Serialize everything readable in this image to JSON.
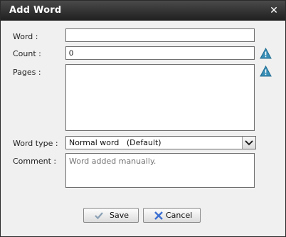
{
  "dialog": {
    "title": "Add Word",
    "close_icon": "close-icon"
  },
  "form": {
    "word_label": "Word :",
    "word_value": "",
    "count_label": "Count :",
    "count_value": "0",
    "pages_label": "Pages :",
    "pages_value": "",
    "word_type_label": "Word type :",
    "word_type_value": "Normal word   (Default)",
    "comment_label": "Comment :",
    "comment_placeholder": "Word added manually.",
    "warning_icon": "warning-icon"
  },
  "buttons": {
    "save_label": "Save",
    "save_icon": "checkmark-icon",
    "cancel_label": "Cancel",
    "cancel_icon": "x-icon"
  },
  "colors": {
    "titlebar": "#2b2b2b",
    "dialog_bg": "#f0f0f0",
    "warning": "#3a8fb6",
    "cancel_icon": "#3d6fd1"
  }
}
